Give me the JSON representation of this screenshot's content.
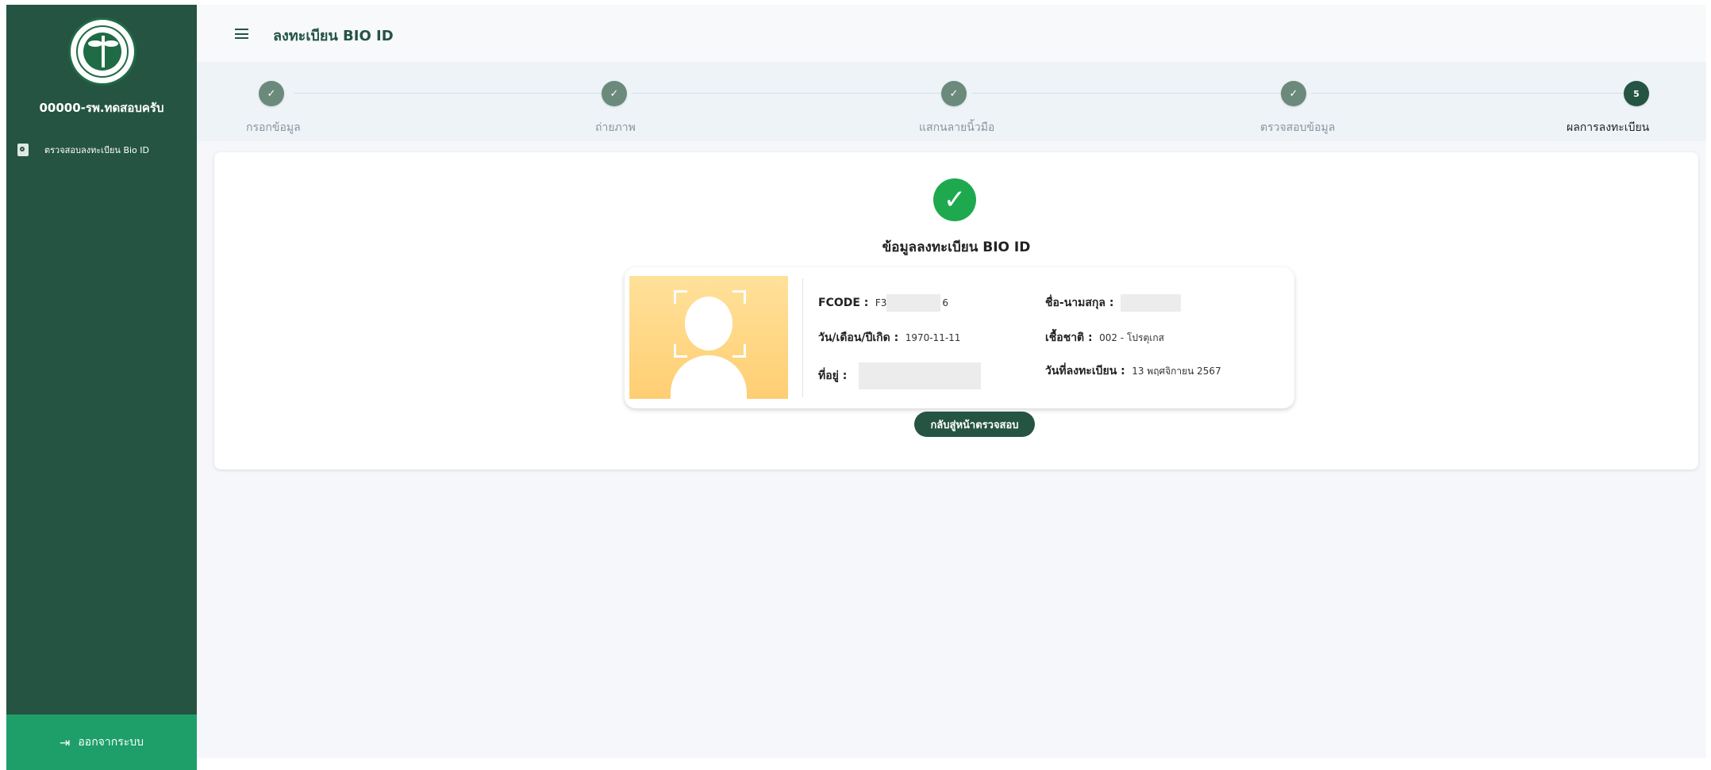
{
  "sidebar": {
    "org_name": "00000-รพ.ทดสอบครับ",
    "menu": [
      {
        "label": "ตรวจสอบลงทะเบียน Bio ID"
      }
    ],
    "logout_label": "ออกจากระบบ"
  },
  "header": {
    "title": "ลงทะเบียน BIO ID"
  },
  "stepper": {
    "steps": [
      {
        "label": "กรอกข้อมูล",
        "status": "done",
        "mark": "✓"
      },
      {
        "label": "ถ่ายภาพ",
        "status": "done",
        "mark": "✓"
      },
      {
        "label": "แสกนลายนิ้วมือ",
        "status": "done",
        "mark": "✓"
      },
      {
        "label": "ตรวจสอบข้อมูล",
        "status": "done",
        "mark": "✓"
      },
      {
        "label": "ผลการลงทะเบียน",
        "status": "active",
        "mark": "5"
      }
    ]
  },
  "result": {
    "title": "ข้อมูลลงทะเบียน BIO ID",
    "fcode_label": "FCODE :",
    "fcode_prefix": "F3",
    "fcode_suffix": "6",
    "name_label": "ชื่อ-นามสกุล :",
    "dob_label": "วัน/เดือน/ปีเกิด :",
    "dob_value": "1970-11-11",
    "nationality_label": "เชื้อชาติ :",
    "nationality_value": "002 - โปรตุเกส",
    "address_label": "ที่อยู่ :",
    "reg_date_label": "วันที่ลงทะเบียน :",
    "reg_date_value": "13 พฤศจิกายน 2567",
    "back_button": "กลับสู่หน้าตรวจสอบ"
  },
  "colors": {
    "sidebar_bg": "#255442",
    "logout_bg": "#1e9f6a",
    "success": "#1fa94f",
    "step_done": "#6b8a7c"
  }
}
